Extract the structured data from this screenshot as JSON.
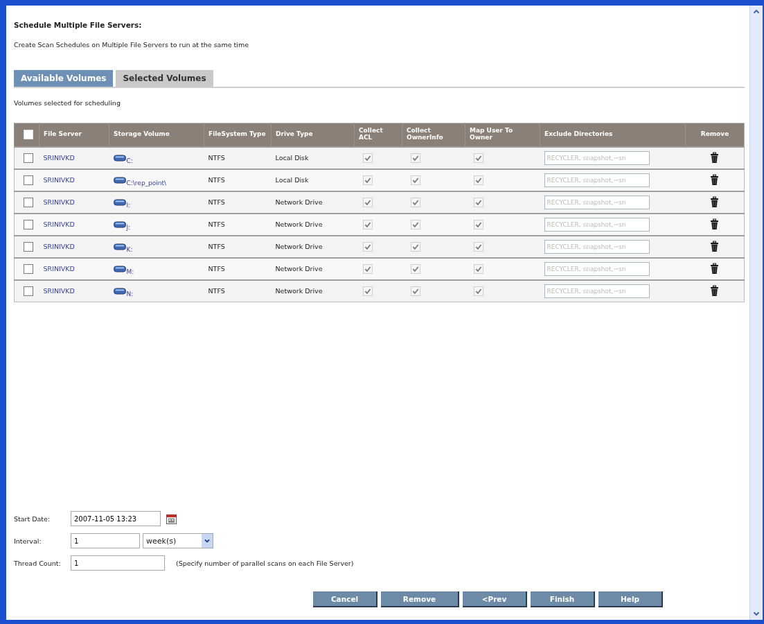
{
  "heading": "Schedule Multiple File Servers:",
  "description": "Create Scan Schedules on Multiple File Servers to run at the same time",
  "tabs": [
    {
      "label": "Available Volumes",
      "selected": true
    },
    {
      "label": "Selected Volumes",
      "selected": false
    }
  ],
  "table_caption": "Volumes selected for scheduling",
  "table": {
    "select_all_checked": false,
    "columns": [
      "File Server",
      "Storage Volume",
      "FileSystem Type",
      "Drive Type",
      "Collect ACL",
      "Collect OwnerInfo",
      "Map User To Owner",
      "Exclude Directories",
      "Remove"
    ],
    "rows": [
      {
        "selected": false,
        "server": "SRINIVKD",
        "volume": "C:",
        "fs_type": "NTFS",
        "drive_type": "Local Disk",
        "collect_acl": true,
        "collect_owner_info": true,
        "map_user": true,
        "exclude_placeholder": "RECYCLER, snapshot,~sn"
      },
      {
        "selected": false,
        "server": "SRINIVKD",
        "volume": "C:\\rep_point\\",
        "fs_type": "NTFS",
        "drive_type": "Local Disk",
        "collect_acl": true,
        "collect_owner_info": true,
        "map_user": true,
        "exclude_placeholder": "RECYCLER, snapshot,~sn"
      },
      {
        "selected": false,
        "server": "SRINIVKD",
        "volume": "I:",
        "fs_type": "NTFS",
        "drive_type": "Network Drive",
        "collect_acl": true,
        "collect_owner_info": true,
        "map_user": true,
        "exclude_placeholder": "RECYCLER, snapshot,~sn"
      },
      {
        "selected": false,
        "server": "SRINIVKD",
        "volume": "J:",
        "fs_type": "NTFS",
        "drive_type": "Network Drive",
        "collect_acl": true,
        "collect_owner_info": true,
        "map_user": true,
        "exclude_placeholder": "RECYCLER, snapshot,~sn"
      },
      {
        "selected": false,
        "server": "SRINIVKD",
        "volume": "K:",
        "fs_type": "NTFS",
        "drive_type": "Network Drive",
        "collect_acl": true,
        "collect_owner_info": true,
        "map_user": true,
        "exclude_placeholder": "RECYCLER, snapshot,~sn"
      },
      {
        "selected": false,
        "server": "SRINIVKD",
        "volume": "M:",
        "fs_type": "NTFS",
        "drive_type": "Network Drive",
        "collect_acl": true,
        "collect_owner_info": true,
        "map_user": true,
        "exclude_placeholder": "RECYCLER, snapshot,~sn"
      },
      {
        "selected": false,
        "server": "SRINIVKD",
        "volume": "N:",
        "fs_type": "NTFS",
        "drive_type": "Network Drive",
        "collect_acl": true,
        "collect_owner_info": true,
        "map_user": true,
        "exclude_placeholder": "RECYCLER, snapshot,~sn"
      }
    ]
  },
  "form": {
    "start_date": {
      "label": "Start Date:",
      "value": "2007-11-05 13:23"
    },
    "interval": {
      "label": "Interval:",
      "value": "1",
      "unit": "week(s)"
    },
    "thread_count": {
      "label": "Thread Count:",
      "value": "1",
      "hint": "(Specify number of parallel scans on each File Server)"
    }
  },
  "buttons": [
    "Cancel",
    "Remove",
    "<Prev",
    "Finish",
    "Help"
  ]
}
